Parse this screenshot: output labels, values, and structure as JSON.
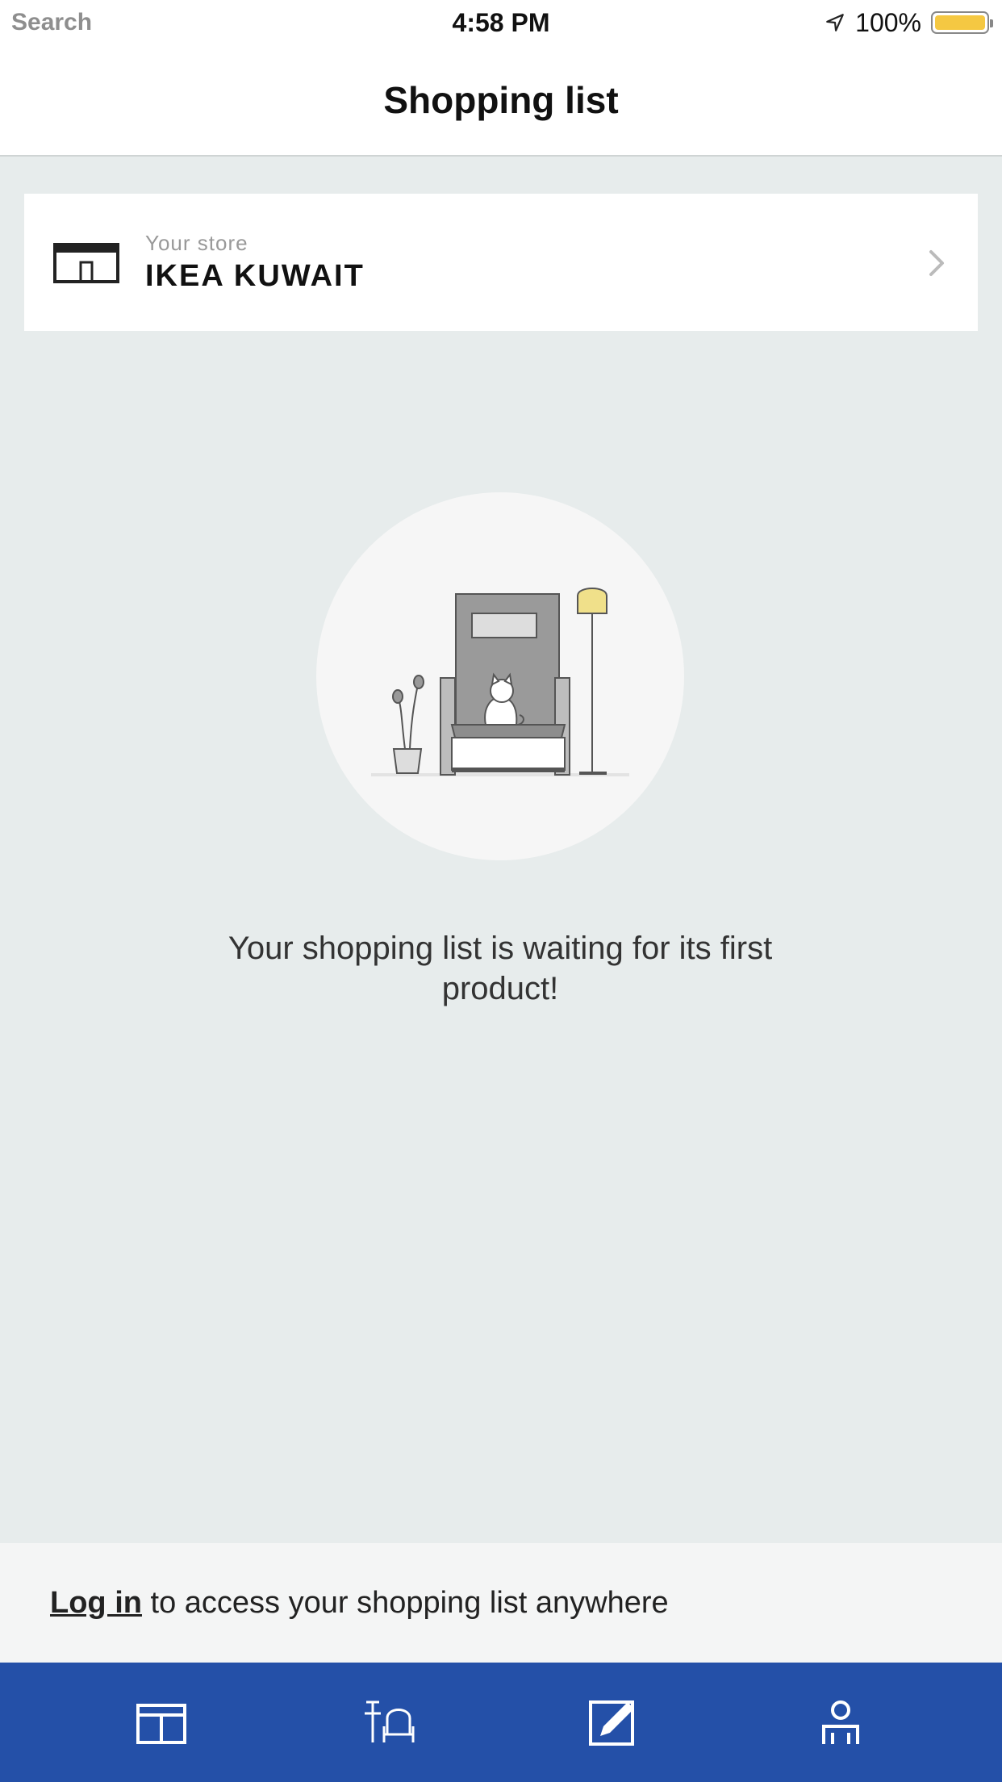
{
  "status_bar": {
    "time": "4:58 PM",
    "battery": "100%",
    "battery_level": 1.0,
    "carrier_hint": "Search"
  },
  "header": {
    "title": "Shopping list"
  },
  "store": {
    "subtitle": "Your store",
    "name": "IKEA KUWAIT",
    "icon": "store-icon",
    "chevron_icon": "chevron-right-icon"
  },
  "empty_state": {
    "illustration": "armchair-cat-illustration",
    "message": "Your shopping list is waiting for its first product!"
  },
  "login": {
    "link_label": "Log in",
    "rest": " to access your shopping list anywhere"
  },
  "tabbar": {
    "items": [
      {
        "icon": "store-icon"
      },
      {
        "icon": "furniture-icon"
      },
      {
        "icon": "shopping-list-icon"
      },
      {
        "icon": "profile-icon"
      }
    ]
  },
  "colors": {
    "background": "#e7ecec",
    "tabbar": "#2450a8",
    "battery_fill": "#f5c842",
    "lamp": "#f0e08a"
  }
}
